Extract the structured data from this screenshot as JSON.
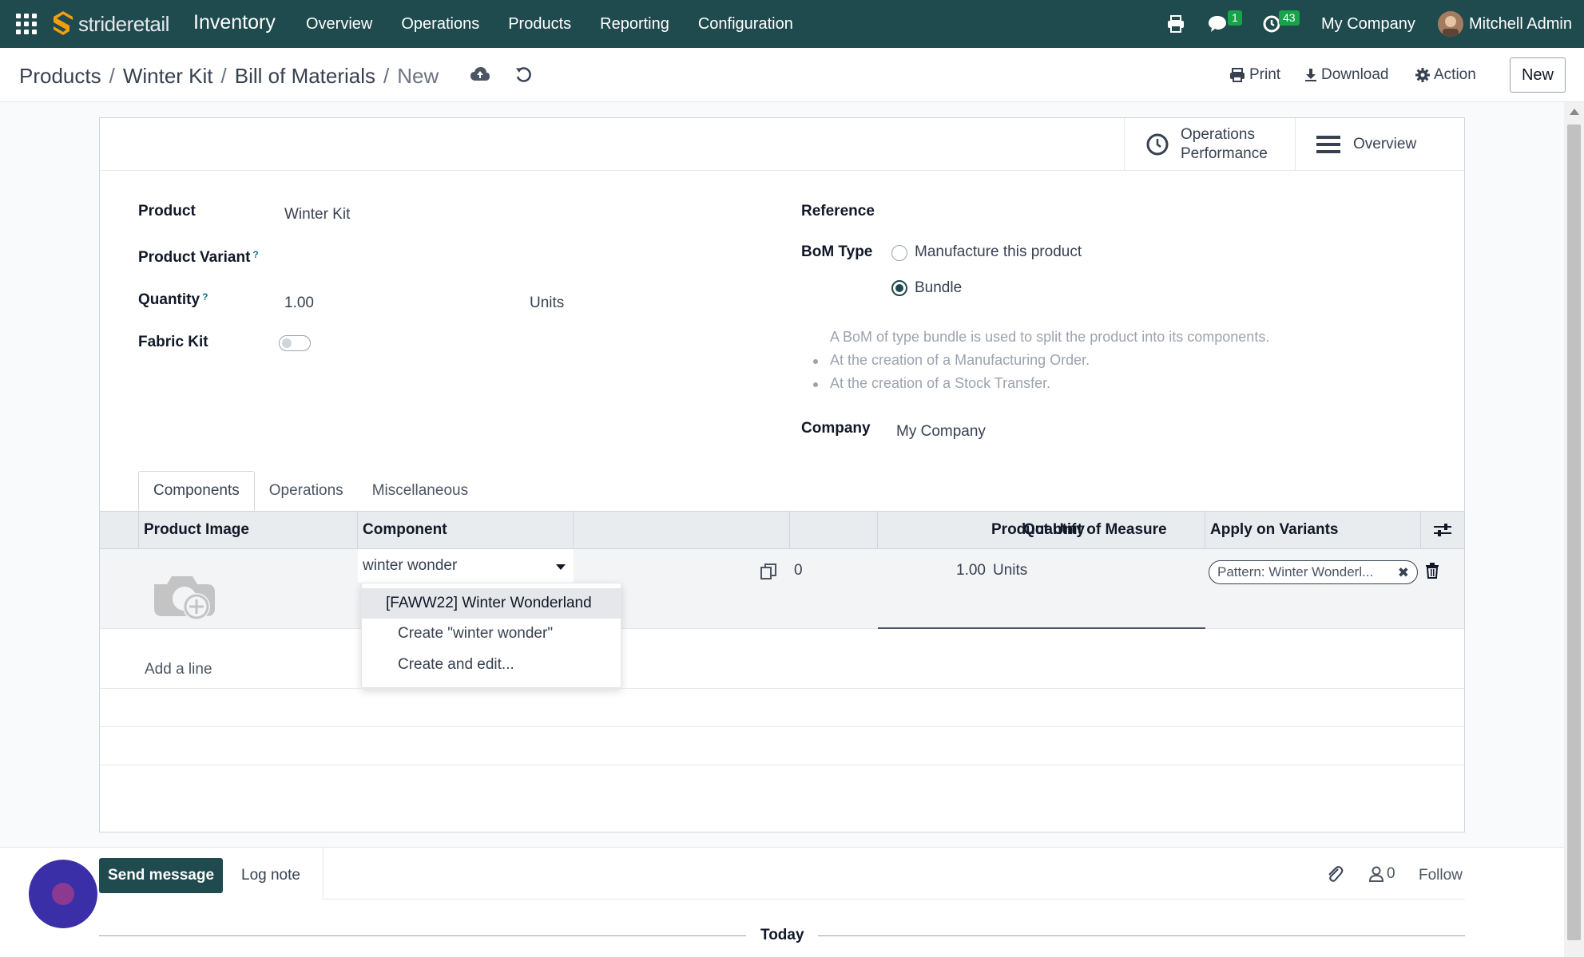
{
  "navbar": {
    "brand": "strideretail",
    "app_name": "Inventory",
    "menu": [
      "Overview",
      "Operations",
      "Products",
      "Reporting",
      "Configuration"
    ],
    "messages_count": "1",
    "activities_count": "43",
    "company": "My Company",
    "user": "Mitchell Admin"
  },
  "breadcrumb": {
    "items": [
      "Products",
      "Winter Kit",
      "Bill of Materials"
    ],
    "current": "New"
  },
  "actions": {
    "print": "Print",
    "download": "Download",
    "action": "Action",
    "new": "New"
  },
  "stat_buttons": {
    "operations_performance_line1": "Operations",
    "operations_performance_line2": "Performance",
    "overview": "Overview"
  },
  "form": {
    "product_label": "Product",
    "product_value": "Winter Kit",
    "variant_label": "Product Variant",
    "quantity_label": "Quantity",
    "quantity_value": "1.00",
    "quantity_uom": "Units",
    "fabric_kit_label": "Fabric Kit",
    "reference_label": "Reference",
    "bom_type_label": "BoM Type",
    "bom_type_options": [
      "Manufacture this product",
      "Bundle"
    ],
    "bom_type_selected": "Bundle",
    "help_intro": "A BoM of type bundle is used to split the product into its components.",
    "help_bullets": [
      "At the creation of a Manufacturing Order.",
      "At the creation of a Stock Transfer."
    ],
    "company_label": "Company",
    "company_value": "My Company"
  },
  "tabs": [
    "Components",
    "Operations",
    "Miscellaneous"
  ],
  "table": {
    "headers": {
      "image": "Product Image",
      "component": "Component",
      "quantity": "Quantity",
      "uom": "Product Unit of Measure",
      "variants": "Apply on Variants"
    },
    "row": {
      "component_input": "winter wonder",
      "count": "0",
      "quantity": "1.00",
      "uom": "Units",
      "variant_tag": "Pattern: Winter Wonderl..."
    },
    "dropdown": [
      "[FAWW22] Winter Wonderland",
      "Create \"winter wonder\"",
      "Create and edit..."
    ],
    "add_line": "Add a line"
  },
  "chatter": {
    "send_message": "Send message",
    "log_note": "Log note",
    "followers_count": "0",
    "follow": "Follow",
    "today": "Today"
  },
  "colors": {
    "navbar": "#1f4a4e",
    "badge": "#16a34a",
    "primary_button": "#1f4a4e"
  }
}
